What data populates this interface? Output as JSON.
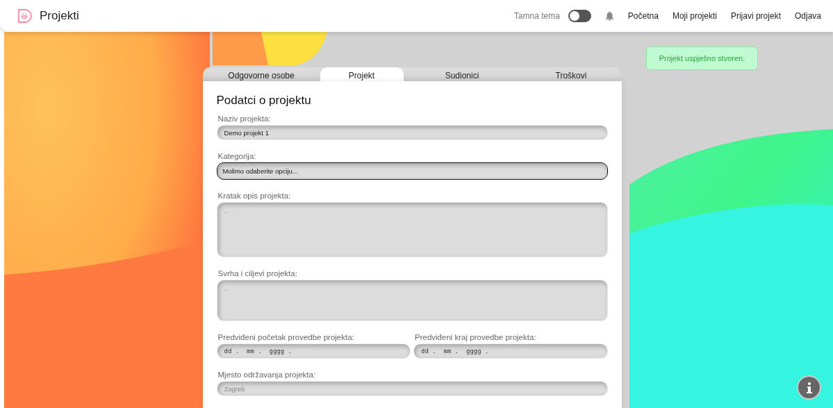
{
  "header": {
    "title": "Projekti",
    "theme_toggle": {
      "label": "Tamna tema",
      "on": false
    },
    "nav": [
      "Početna",
      "Moji projekti",
      "Prijavi projekt",
      "Odjava"
    ]
  },
  "toast": {
    "message": "Projekt uspješno stvoren."
  },
  "tabs": [
    {
      "label": "Odgovorne osobe",
      "selected": false
    },
    {
      "label": "Projekt",
      "selected": true
    },
    {
      "label": "Sudionici",
      "selected": false
    },
    {
      "label": "Troškovi",
      "selected": false
    }
  ],
  "form": {
    "title": "Podatci o projektu",
    "rows": [
      [
        {
          "kind": "text",
          "label": "Naziv projekta:",
          "value": "Demo projekt 1",
          "focused": false
        }
      ],
      [
        {
          "kind": "select",
          "label": "Kategorija:",
          "value": "Molimo odaberite opciju...",
          "focused": true
        }
      ],
      [
        {
          "kind": "textarea",
          "label": "Kratak opis projekta:",
          "placeholder": "...",
          "focused": false
        }
      ],
      [
        {
          "kind": "textarea-short",
          "label": "Svrha i ciljevi projekta:",
          "placeholder": "...",
          "focused": false
        }
      ],
      [
        {
          "kind": "date",
          "label": "Predviđeni početak provedbe projekta:",
          "placeholder": "dd .  mm .  gggg .",
          "focused": false
        },
        {
          "kind": "date",
          "label": "Predviđeni kraj provedbe projekta:",
          "placeholder": "dd .  mm .  gggg .",
          "focused": false
        }
      ],
      [
        {
          "kind": "text",
          "label": "Mjesto održavanja projekta:",
          "placeholder": "Zagreb",
          "focused": false
        }
      ]
    ]
  }
}
